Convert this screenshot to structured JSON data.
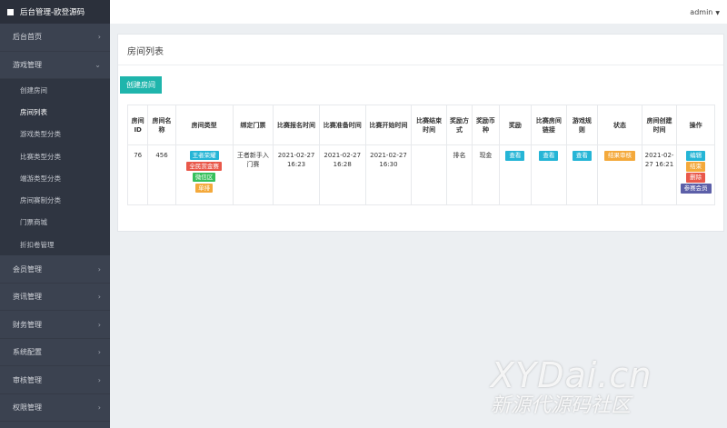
{
  "app": {
    "title": "后台管理-欧登源码"
  },
  "topbar": {
    "user": "admin"
  },
  "sidebar": {
    "items_before": [
      {
        "label": "后台首页"
      },
      {
        "label": "游戏管理"
      }
    ],
    "submenu": [
      {
        "label": "创建房间"
      },
      {
        "label": "房间列表"
      },
      {
        "label": "游戏类型分类"
      },
      {
        "label": "比赛类型分类"
      },
      {
        "label": "端游类型分类"
      },
      {
        "label": "房间赛制分类"
      },
      {
        "label": "门票商城"
      },
      {
        "label": "折扣卷管理"
      }
    ],
    "items_after": [
      {
        "label": "会员管理"
      },
      {
        "label": "资讯管理"
      },
      {
        "label": "财务管理"
      },
      {
        "label": "系统配置"
      },
      {
        "label": "审核管理"
      },
      {
        "label": "权限管理"
      }
    ]
  },
  "panel": {
    "title": "房间列表",
    "create_label": "创建房间"
  },
  "table": {
    "headers": {
      "id": "房间ID",
      "name": "房间名称",
      "type": "房间类型",
      "ticket": "绑定门票",
      "signup": "比赛报名时间",
      "prepare": "比赛准备时间",
      "start": "比赛开始时间",
      "end": "比赛结束时间",
      "reward_mode": "奖励方式",
      "currency": "奖励币种",
      "reward": "奖励",
      "link": "比赛房间链接",
      "rules": "游戏规则",
      "status": "状态",
      "created": "房间创建时间",
      "ops": "操作"
    },
    "row": {
      "id": "76",
      "name": "456",
      "types": [
        "王者荣耀",
        "全民赏金赛",
        "微信区",
        "单排"
      ],
      "ticket": "王者新手入门赛",
      "signup": "2021-02-27 16:23",
      "prepare": "2021-02-27 16:28",
      "start": "2021-02-27 16:30",
      "end": "",
      "reward_mode": "排名",
      "currency": "现金",
      "reward_btn": "查看",
      "link_btn": "查看",
      "rules_btn": "查看",
      "status_btn": "结果审核",
      "created": "2021-02-27 16:21",
      "ops": [
        "编辑",
        "结束",
        "删除",
        "参赛会员"
      ]
    }
  },
  "colors": {
    "teal": "#1fb5ac",
    "info": "#25b5d6",
    "danger": "#e9584a",
    "success": "#36c05c",
    "warning": "#f4a93b",
    "purple": "#5c5fa8"
  },
  "watermark": {
    "line1": "XYDai.cn",
    "line2": "新源代源码社区"
  }
}
